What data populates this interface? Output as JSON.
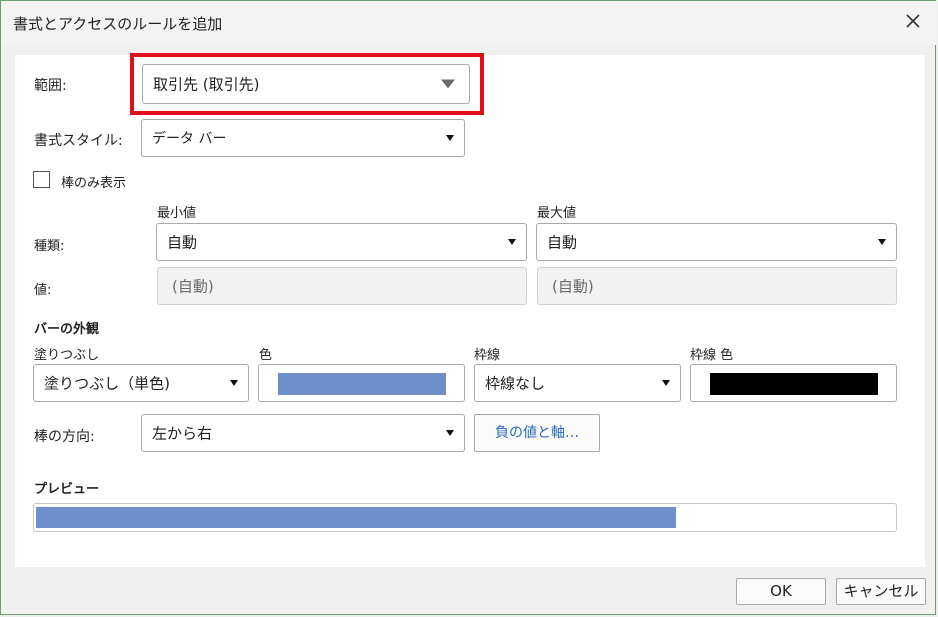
{
  "window": {
    "title": "書式とアクセスのルールを追加"
  },
  "range": {
    "label": "範囲:",
    "value": "取引先 (取引先)"
  },
  "format_style": {
    "label": "書式スタイル:",
    "value": "データ バー"
  },
  "bar_only": {
    "label": "棒のみ表示",
    "checked": false
  },
  "min_max": {
    "min_header": "最小値",
    "max_header": "最大値",
    "type_label": "種類:",
    "min_type": "自動",
    "max_type": "自動",
    "value_label": "値:",
    "min_value": "(自動)",
    "max_value": "(自動)"
  },
  "bar_appearance": {
    "heading": "バーの外観",
    "fill_label": "塗りつぶし",
    "fill_value": "塗りつぶし（単色)",
    "color_label": "色",
    "fill_color": "#6e8fc9",
    "border_label": "枠線",
    "border_value": "枠線なし",
    "border_color_label": "枠線 色",
    "border_color": "#000000"
  },
  "direction": {
    "label": "棒の方向:",
    "value": "左から右",
    "negative_button": "負の値と軸…"
  },
  "preview": {
    "label": "プレビュー",
    "fill_fraction": 0.746,
    "color": "#6e8fc9"
  },
  "footer": {
    "ok": "OK",
    "cancel": "キャンセル"
  }
}
